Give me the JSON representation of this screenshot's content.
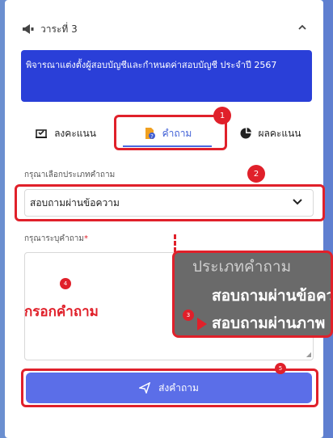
{
  "agenda": {
    "header_title": "วาระที่ 3",
    "description": "พิจารณาแต่งตั้งผู้สอบบัญชีและกำหนดค่าสอบบัญชี ประจำปี 2567"
  },
  "tabs": [
    {
      "label": "ลงคะแนน"
    },
    {
      "label": "คำถาม"
    },
    {
      "label": "ผลคะแนน"
    }
  ],
  "form": {
    "type_label": "กรุณาเลือกประเภทคำถาม",
    "type_value": "สอบถามผ่านข้อความ",
    "question_label": "กรุณาระบุคำถาม",
    "required_mark": "*",
    "question_hint": "กรอกคำถาม",
    "submit_label": "ส่งคำถาม"
  },
  "popup": {
    "title": "ประเภทคำถาม",
    "options": [
      "สอบถามผ่านข้อความ",
      "สอบถามผ่านภาพ"
    ]
  },
  "badges": [
    "1",
    "2",
    "3",
    "4",
    "5"
  ],
  "colors": {
    "primary": "#2a3fd8",
    "accent": "#5b6ee8",
    "highlight": "#e0202a",
    "tab_active": "#3f5fd6"
  },
  "icons": [
    "megaphone-icon",
    "chevron-up-icon",
    "vote-icon",
    "question-icon",
    "pie-chart-icon",
    "chevron-down-icon",
    "send-icon"
  ]
}
